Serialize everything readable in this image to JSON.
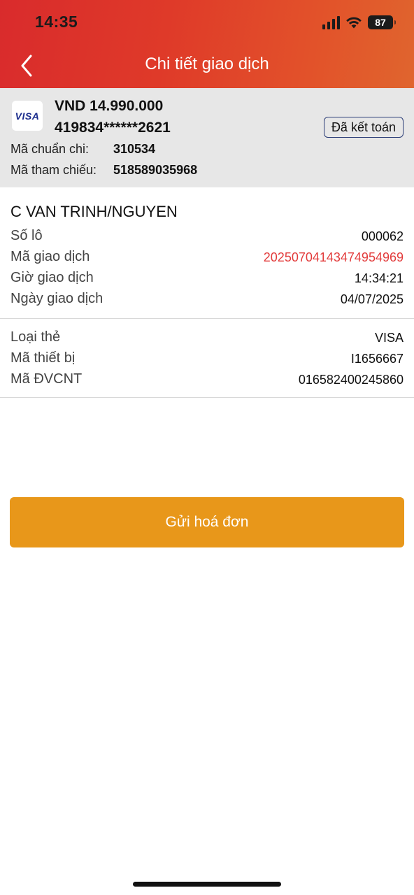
{
  "status_bar": {
    "time": "14:35",
    "battery": "87"
  },
  "nav": {
    "title": "Chi tiết giao dịch"
  },
  "summary": {
    "card_brand": "VISA",
    "amount": "VND 14.990.000",
    "card_number": "419834******2621",
    "status": "Đã kết toán",
    "approval_label": "Mã chuẩn chi:",
    "approval_value": "310534",
    "reference_label": "Mã tham chiếu:",
    "reference_value": "518589035968"
  },
  "details": {
    "customer_name": "C VAN TRINH/NGUYEN",
    "rows": [
      {
        "label": "Số lô",
        "value": "000062"
      },
      {
        "label": "Mã giao dịch",
        "value": "20250704143474954969"
      },
      {
        "label": "Giờ giao dịch",
        "value": "14:34:21"
      },
      {
        "label": "Ngày giao dịch",
        "value": "04/07/2025"
      }
    ],
    "device_rows": [
      {
        "label": "Loại thẻ",
        "value": "VISA"
      },
      {
        "label": "Mã thiết bị",
        "value": "I1656667"
      },
      {
        "label": "Mã ĐVCNT",
        "value": "016582400245860"
      }
    ]
  },
  "actions": {
    "send_invoice": "Gửi hoá đơn"
  },
  "colors": {
    "header_start": "#d92b2c",
    "header_end": "#e0652e",
    "button": "#e8971a",
    "transaction_id": "#e23b3b",
    "summary_bg": "#e7e7e7"
  }
}
